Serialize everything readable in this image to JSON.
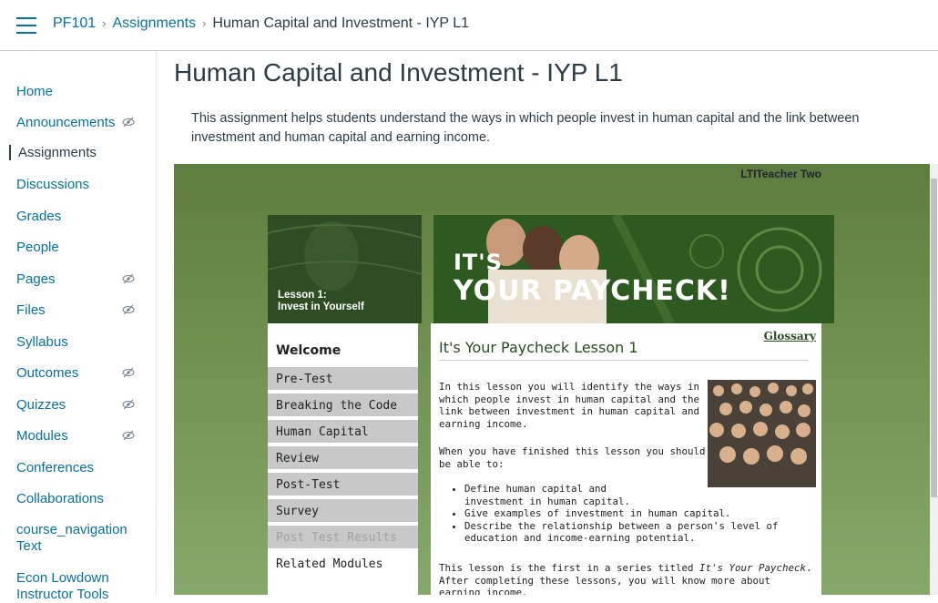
{
  "breadcrumb": {
    "course": "PF101",
    "section": "Assignments",
    "current": "Human Capital and Investment - IYP L1",
    "separator": "›"
  },
  "nav": {
    "items": [
      {
        "label": "Home",
        "hidden_icon": false
      },
      {
        "label": "Announcements",
        "hidden_icon": true
      },
      {
        "label": "Assignments",
        "hidden_icon": false,
        "active": true
      },
      {
        "label": "Discussions",
        "hidden_icon": false
      },
      {
        "label": "Grades",
        "hidden_icon": false
      },
      {
        "label": "People",
        "hidden_icon": false
      },
      {
        "label": "Pages",
        "hidden_icon": true
      },
      {
        "label": "Files",
        "hidden_icon": true
      },
      {
        "label": "Syllabus",
        "hidden_icon": false
      },
      {
        "label": "Outcomes",
        "hidden_icon": true
      },
      {
        "label": "Quizzes",
        "hidden_icon": true
      },
      {
        "label": "Modules",
        "hidden_icon": true
      },
      {
        "label": "Conferences",
        "hidden_icon": false
      },
      {
        "label": "Collaborations",
        "hidden_icon": false
      },
      {
        "label": "course_navigation Text",
        "hidden_icon": false
      },
      {
        "label": "Econ Lowdown Instructor Tools",
        "hidden_icon": false
      }
    ]
  },
  "page": {
    "title": "Human Capital and Investment - IYP L1",
    "description": "This assignment helps students understand the ways in which people invest in human capital and the link between investment and human capital and earning income."
  },
  "tool": {
    "user": "LTITeacher Two",
    "lesson_label_line1": "Lesson 1:",
    "lesson_label_line2": "Invest in Yourself",
    "banner_line1": "IT'S",
    "banner_line2": "YOUR PAYCHECK!",
    "menu": {
      "heading": "Welcome",
      "items": [
        {
          "label": "Pre-Test",
          "state": "normal"
        },
        {
          "label": "Breaking the Code",
          "state": "normal"
        },
        {
          "label": "Human Capital",
          "state": "normal"
        },
        {
          "label": "Review",
          "state": "normal"
        },
        {
          "label": "Post-Test",
          "state": "normal"
        },
        {
          "label": "Survey",
          "state": "normal"
        },
        {
          "label": "Post Test Results",
          "state": "disabled"
        },
        {
          "label": "Related Modules",
          "state": "plain"
        }
      ]
    },
    "content": {
      "glossary": "Glossary",
      "heading": "It's Your Paycheck Lesson 1",
      "para1": "In this lesson you will identify the ways in which people invest in human capital and the link between investment in human capital and earning income.",
      "para2": "When you have finished this lesson you should be able to:",
      "bullets": [
        "Define human capital and investment in human capital.",
        "Give examples of investment in human capital.",
        "Describe the relationship between a person's level of education and income-earning potential."
      ],
      "para3_prefix": "This lesson is the first in a series titled ",
      "para3_italic": "It's Your Paycheck",
      "para3_suffix": ". After completing these lessons, you will know more about earning income,"
    }
  },
  "colors": {
    "link": "#0770a3",
    "text": "#2d3b45",
    "frame_green": "#6a8a4a",
    "dark_green": "#2d4a22",
    "menu_gray": "#c8c8c8"
  }
}
